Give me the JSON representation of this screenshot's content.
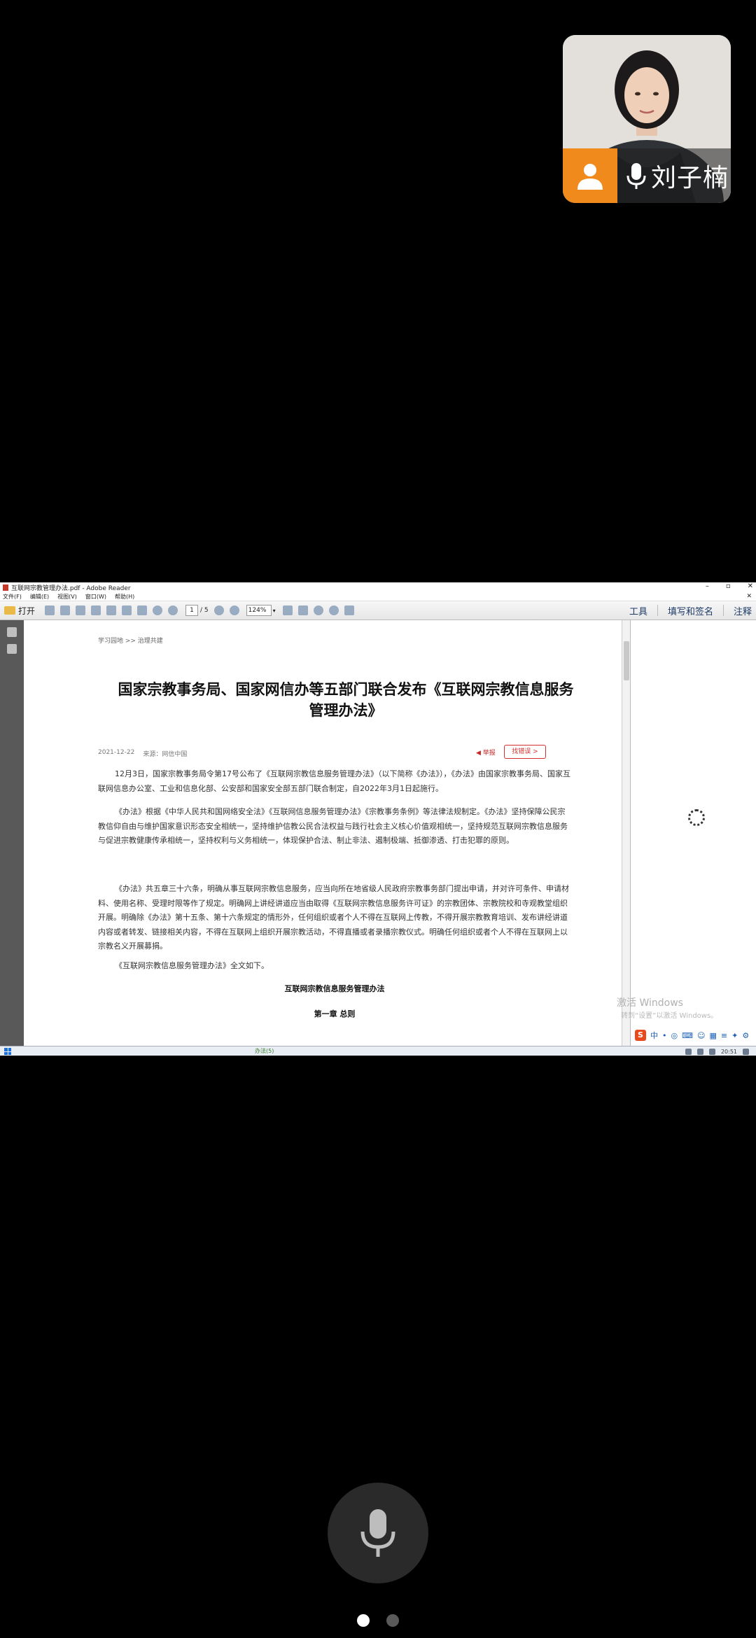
{
  "participant": {
    "name": "刘子楠"
  },
  "window": {
    "title": "互联网宗教管理办法.pdf - Adobe Reader",
    "controls": [
      "–",
      "▫",
      "✕"
    ],
    "menu": [
      "文件(F)",
      "编辑(E)",
      "视图(V)",
      "窗口(W)",
      "帮助(H)"
    ],
    "close_doc": "✕"
  },
  "toolbar": {
    "open_label": "打开",
    "page_current": "1",
    "page_total": "/ 5",
    "zoom": "124%",
    "right_items": [
      "工具",
      "填写和签名",
      "注释"
    ]
  },
  "document": {
    "breadcrumb": "学习园地 >> 治理共建",
    "title": "国家宗教事务局、国家网信办等五部门联合发布《互联网宗教信息服务管理办法》",
    "date": "2021-12-22",
    "source": "来源：网信中国",
    "report": "◀ 举报",
    "wrong_button": "找错误 >",
    "paragraphs": [
      "12月3日，国家宗教事务局令第17号公布了《互联网宗教信息服务管理办法》（以下简称《办法》），《办法》由国家宗教事务局、国家互联网信息办公室、工业和信息化部、公安部和国家安全部五部门联合制定，自2022年3月1日起施行。",
      "《办法》根据《中华人民共和国网络安全法》《互联网信息服务管理办法》《宗教事务条例》等法律法规制定。《办法》坚持保障公民宗教信仰自由与维护国家意识形态安全相统一，坚持维护信教公民合法权益与践行社会主义核心价值观相统一，坚持规范互联网宗教信息服务与促进宗教健康传承相统一，坚持权利与义务相统一，体现保护合法、制止非法、遏制极端、抵御渗透、打击犯罪的原则。",
      "《办法》共五章三十六条，明确从事互联网宗教信息服务，应当向所在地省级人民政府宗教事务部门提出申请，并对许可条件、申请材料、使用名称、受理时限等作了规定。明确网上讲经讲道应当由取得《互联网宗教信息服务许可证》的宗教团体、宗教院校和寺观教堂组织开展。明确除《办法》第十五条、第十六条规定的情形外，任何组织或者个人不得在互联网上传教，不得开展宗教教育培训、发布讲经讲道内容或者转发、链接相关内容，不得在互联网上组织开展宗教活动，不得直播或者录播宗教仪式。明确任何组织或者个人不得在互联网上以宗教名义开展募捐。",
      "《互联网宗教信息服务管理办法》全文如下。"
    ],
    "subtitle": "互联网宗教信息服务管理办法",
    "chapter": "第一章 总则"
  },
  "desktop": {
    "activate_line1": "激活 Windows",
    "activate_line2": "转到“设置”以激活 Windows。",
    "ime": [
      "S",
      "中",
      "•",
      "◎",
      "⌨",
      "☺",
      "▦",
      "≡",
      "✦",
      "⚙"
    ],
    "taskbar_label": "办法(5)",
    "clock": "20:51"
  },
  "colors": {
    "avatar_bg": "#f08a1c",
    "report_red": "#c62828"
  }
}
